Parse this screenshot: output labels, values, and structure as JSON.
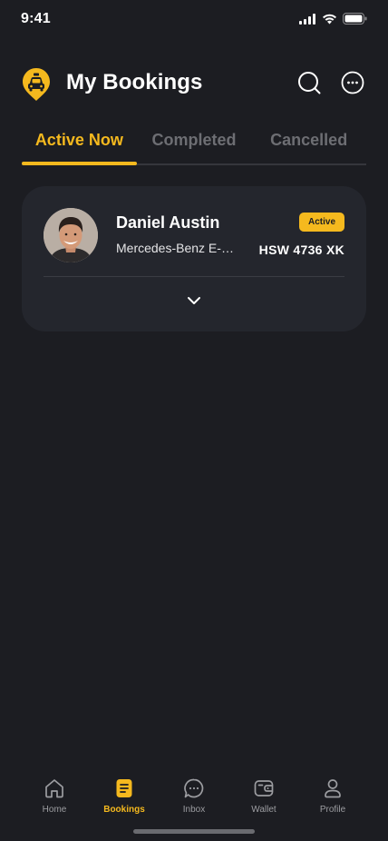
{
  "status_bar": {
    "time": "9:41"
  },
  "header": {
    "title": "My Bookings"
  },
  "tabs": [
    {
      "label": "Active Now",
      "active": true
    },
    {
      "label": "Completed",
      "active": false
    },
    {
      "label": "Cancelled",
      "active": false
    }
  ],
  "booking": {
    "driver_name": "Daniel Austin",
    "car_model": "Mercedes-Benz E-Class",
    "status": "Active",
    "plate": "HSW 4736 XK"
  },
  "nav": [
    {
      "label": "Home",
      "icon": "home-icon",
      "active": false
    },
    {
      "label": "Bookings",
      "icon": "document-icon",
      "active": true
    },
    {
      "label": "Inbox",
      "icon": "chat-icon",
      "active": false
    },
    {
      "label": "Wallet",
      "icon": "wallet-icon",
      "active": false
    },
    {
      "label": "Profile",
      "icon": "user-icon",
      "active": false
    }
  ],
  "colors": {
    "accent": "#f5b91e",
    "background": "#1c1d22",
    "card": "#24262d",
    "muted": "#6d6e73"
  }
}
